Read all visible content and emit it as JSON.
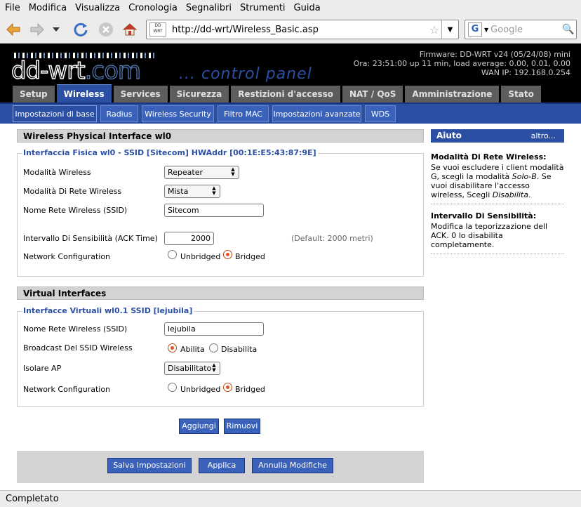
{
  "menu": [
    "File",
    "Modifica",
    "Visualizza",
    "Cronologia",
    "Segnalibri",
    "Strumenti",
    "Guida"
  ],
  "url": "http://dd-wrt/Wireless_Basic.asp",
  "search_placeholder": "Google",
  "header": {
    "logo": "dd-wrt",
    "logo_com": ".com",
    "control_panel": "... control panel",
    "firmware": "Firmware: DD-WRT v24 (05/24/08) mini",
    "time": "Ora: 23:51:00 up 11 min, load average: 0.00, 0.01, 0.00",
    "wan_ip": "WAN IP: 192.168.0.254"
  },
  "main_tabs": [
    "Setup",
    "Wireless",
    "Services",
    "Sicurezza",
    "Restizioni d'accesso",
    "NAT / QoS",
    "Amministrazione",
    "Stato"
  ],
  "sub_tabs": [
    "Impostazioni di base",
    "Radius",
    "Wireless Security",
    "Filtro MAC",
    "Impostazioni avanzate",
    "WDS"
  ],
  "physical": {
    "section_title": "Wireless Physical Interface wl0",
    "legend": "Interfaccia Fisica wl0 - SSID [Sitecom] HWAddr [00:1E:E5:43:87:9E]",
    "mode_label": "Modalità Wireless",
    "mode_value": "Repeater",
    "netmode_label": "Modalità Di Rete Wireless",
    "netmode_value": "Mista",
    "ssid_label": "Nome Rete Wireless (SSID)",
    "ssid_value": "Sitecom",
    "ack_label": "Intervallo Di Sensibilità (ACK Time)",
    "ack_value": "2000",
    "ack_hint": "(Default: 2000 metri)",
    "netconf_label": "Network Configuration",
    "unbridged": "Unbridged",
    "bridged": "Bridged"
  },
  "virtual": {
    "section_title": "Virtual Interfaces",
    "legend": "Interfacce Virtuali wl0.1 SSID [lejubila]",
    "ssid_label": "Nome Rete Wireless (SSID)",
    "ssid_value": "lejubila",
    "broadcast_label": "Broadcast Del SSID Wireless",
    "abilita": "Abilita",
    "disabilita": "Disabilita",
    "isolate_label": "Isolare AP",
    "isolate_value": "Disabilitato",
    "netconf_label": "Network Configuration",
    "unbridged": "Unbridged",
    "bridged": "Bridged"
  },
  "buttons": {
    "add": "Aggiungi",
    "remove": "Rimuovi",
    "save": "Salva Impostazioni",
    "apply": "Applica",
    "cancel": "Annulla Modifiche"
  },
  "help": {
    "title": "Aiuto",
    "more": "altro...",
    "t1": "Modalità Di Rete Wireless:",
    "p1a": "Se vuoi escludere i client modalità G, scegli la modalità ",
    "p1b": "Solo-B",
    "p1c": ". Se vuoi disabilitare l'accesso wireless, Scegli ",
    "p1d": "Disabilita",
    "p1e": ".",
    "t2": "Intervallo Di Sensibilità:",
    "p2": "Modifica la teporizzazione dell ACK. 0 lo disabilita completamente."
  },
  "status": "Completato"
}
